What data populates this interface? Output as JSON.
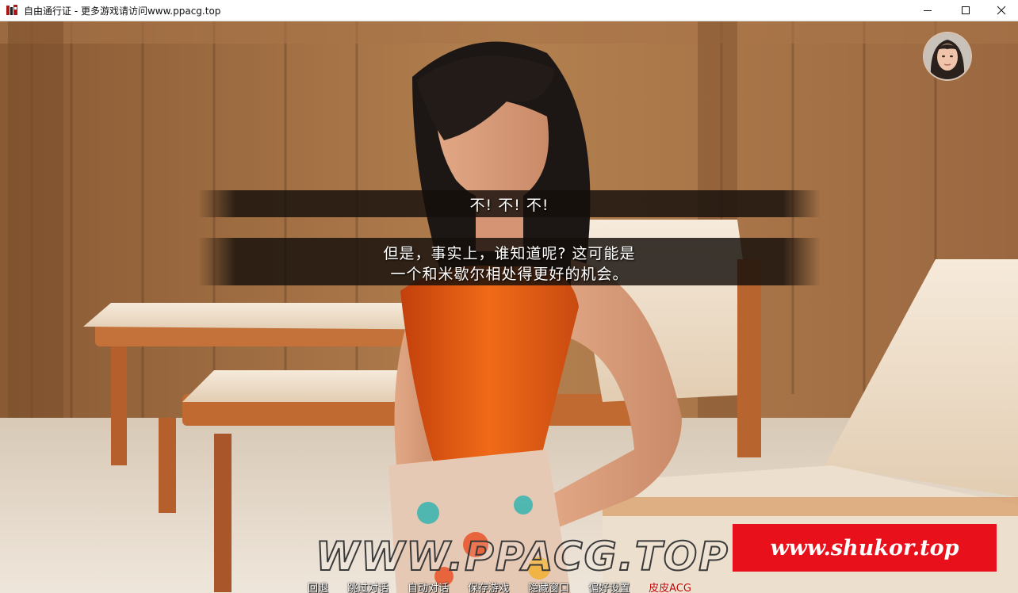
{
  "window": {
    "title": "自由通行证 - 更多游戏请访问www.ppacg.top",
    "icon": "app-icon",
    "controls": [
      "minimize-icon",
      "maximize-icon",
      "close-icon"
    ]
  },
  "dialogue": {
    "line1": "不! 不! 不!",
    "line2a": "但是，事实上，谁知道呢? 这可能是",
    "line2b": "一个和米歇尔相处得更好的机会。"
  },
  "watermarks": {
    "ppacg": "WWW.PPACG.TOP",
    "shukor": "www.shukor.top"
  },
  "quick_menu": [
    {
      "label": "回退"
    },
    {
      "label": "跳过对话"
    },
    {
      "label": "自动对话"
    },
    {
      "label": "保存游戏"
    },
    {
      "label": "隐藏窗口"
    },
    {
      "label": "偏好设置"
    },
    {
      "label": "皮皮ACG"
    }
  ],
  "colors": {
    "accent_red": "#e8101a",
    "menu_accent": "#c40000"
  }
}
